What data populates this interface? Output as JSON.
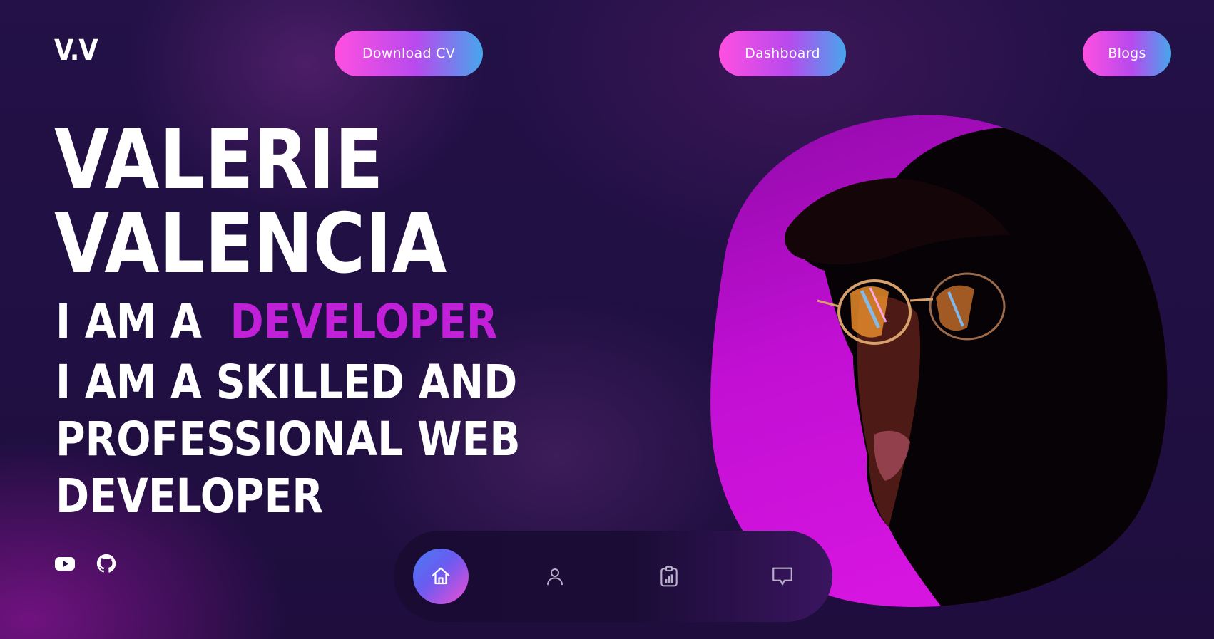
{
  "header": {
    "logo": "V.V",
    "download_cv": "Download CV",
    "dashboard": "Dashboard",
    "blogs": "Blogs"
  },
  "hero": {
    "name_line1": "VALERIE",
    "name_line2": "VALENCIA",
    "role_prefix": "I AM A ",
    "role_highlight": "DEVELOPER",
    "tagline_line1": "I AM A SKILLED AND",
    "tagline_line2": "PROFESSIONAL WEB",
    "tagline_line3": "DEVELOPER"
  },
  "social": {
    "icons": [
      "youtube-icon",
      "github-icon"
    ]
  },
  "dock": {
    "active": "home",
    "items": [
      "home-icon",
      "user-icon",
      "clipboard-chart-icon",
      "chat-icon"
    ]
  },
  "colors": {
    "accent_pink": "#ff4fe0",
    "accent_blue": "#47a6ec",
    "highlight_magenta": "#c21fd9",
    "background": "#1f0f3d"
  }
}
